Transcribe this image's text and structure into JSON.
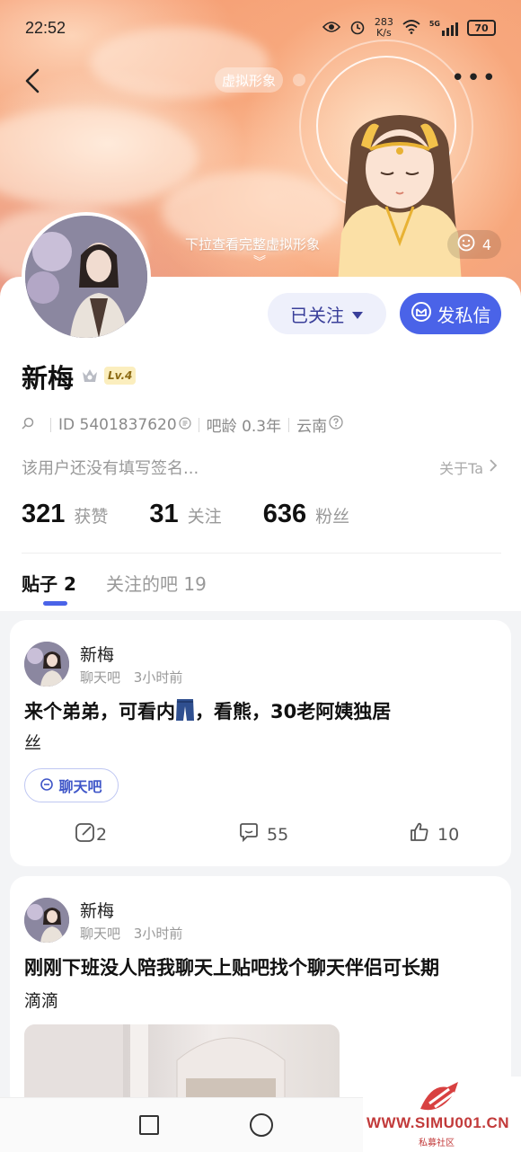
{
  "status_bar": {
    "time": "22:52",
    "speed_value": "283",
    "speed_unit": "K/s",
    "network": "5G",
    "battery": "70"
  },
  "header": {
    "avatar_pill": "虚拟形象",
    "pull_hint": "下拉查看完整虚拟形象",
    "like_count": "4"
  },
  "profile": {
    "follow_label": "已关注",
    "message_label": "发私信",
    "name": "新梅",
    "level": "Lv.4",
    "id_text": "ID 5401837620",
    "age_text": "吧龄 0.3年",
    "location": "云南",
    "signature": "该用户还没有填写签名...",
    "about_label": "关于Ta"
  },
  "stats": [
    {
      "value": "321",
      "label": "获赞"
    },
    {
      "value": "31",
      "label": "关注"
    },
    {
      "value": "636",
      "label": "粉丝"
    }
  ],
  "tabs": {
    "posts": "贴子 2",
    "followed_forums": "关注的吧 19"
  },
  "posts": [
    {
      "author": "新梅",
      "forum": "聊天吧",
      "time": "3小时前",
      "title_before_emoji": "来个弟弟，可看内",
      "title_after_emoji": "，看熊，30老阿姨独居",
      "body": "丝",
      "tag": "聊天吧",
      "shares": "2",
      "comments": "55",
      "likes": "10"
    },
    {
      "author": "新梅",
      "forum": "聊天吧",
      "time": "3小时前",
      "title": "刚刚下班没人陪我聊天上贴吧找个聊天伴侣可长期",
      "body": "滴滴"
    }
  ],
  "watermark": {
    "text": "WWW.SIMU001.CN",
    "sub": "私募社区"
  },
  "colors": {
    "accent": "#4a63e8",
    "follow_bg": "#eef0fb",
    "level_bg": "#fbeebe"
  }
}
